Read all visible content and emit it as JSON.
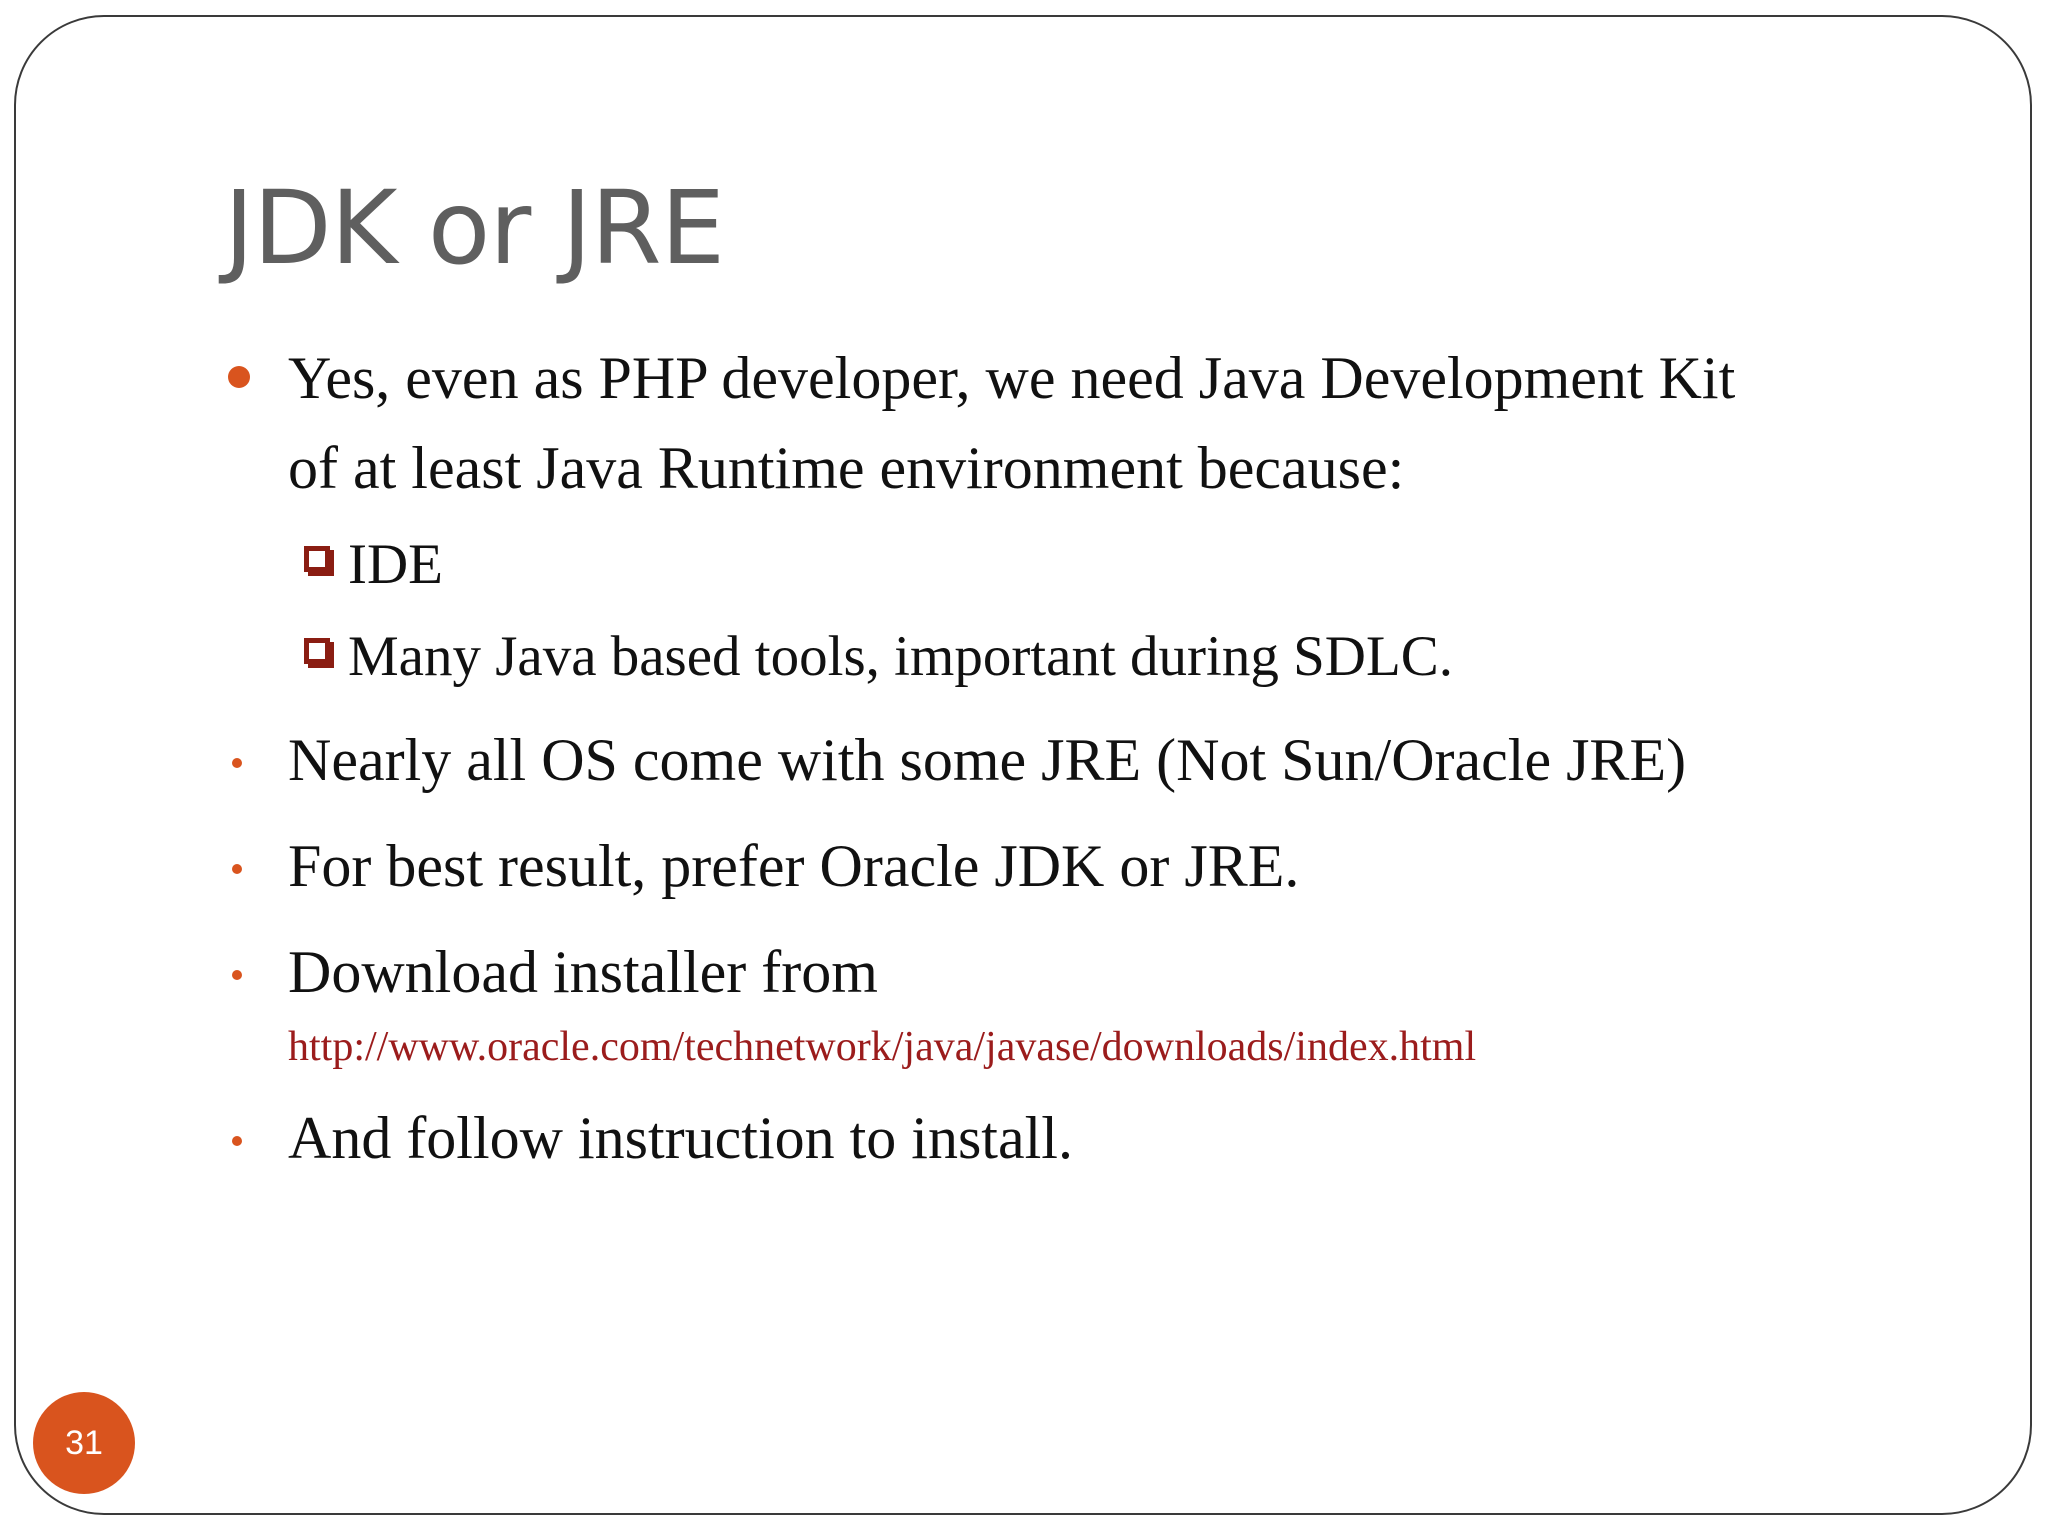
{
  "slide": {
    "title": "JDK or JRE",
    "page_number": "31",
    "accent_color": "#d9541e",
    "sub_bullet_color": "#8a1d12",
    "link_color": "#9b1c1c",
    "bullets": [
      {
        "lines": [
          "Yes, even as PHP developer, we need Java Development Kit",
          "of at least Java Runtime environment because:"
        ],
        "sub_items": [
          "IDE",
          "Many Java based tools, important during SDLC."
        ]
      },
      {
        "text": "Nearly all OS come with some JRE (Not Sun/Oracle JRE)"
      },
      {
        "text": "For best result, prefer Oracle JDK or JRE."
      },
      {
        "text": "Download installer from",
        "link": "http://www.oracle.com/technetwork/java/javase/downloads/index.html"
      },
      {
        "text": "And follow instruction to install."
      }
    ]
  }
}
